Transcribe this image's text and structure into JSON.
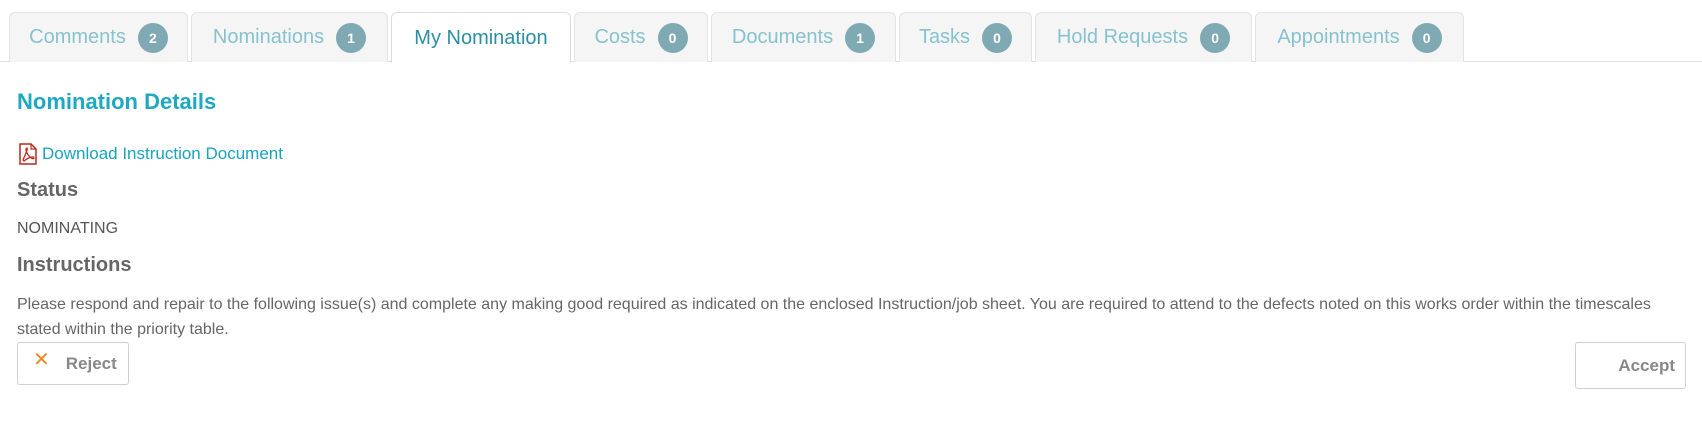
{
  "tabs": [
    {
      "label": "Comments",
      "count": "2",
      "active": false
    },
    {
      "label": "Nominations",
      "count": "1",
      "active": false
    },
    {
      "label": "My Nomination",
      "count": null,
      "active": true
    },
    {
      "label": "Costs",
      "count": "0",
      "active": false
    },
    {
      "label": "Documents",
      "count": "1",
      "active": false
    },
    {
      "label": "Tasks",
      "count": "0",
      "active": false
    },
    {
      "label": "Hold Requests",
      "count": "0",
      "active": false
    },
    {
      "label": "Appointments",
      "count": "0",
      "active": false
    }
  ],
  "section": {
    "title": "Nomination Details",
    "download_link": "Download Instruction Document",
    "download_icon": "pdf-icon",
    "status_label": "Status",
    "status_value": "NOMINATING",
    "instructions_label": "Instructions",
    "instructions_text": "Please respond and repair to the following issue(s) and complete any making good required as indicated on the enclosed Instruction/job sheet. You are required to attend to the defects noted on this works order within the timescales stated within the priority table."
  },
  "actions": {
    "reject_label": "Reject",
    "reject_icon": "close-icon",
    "accept_label": "Accept"
  },
  "colors": {
    "accent": "#1fa8c2",
    "badge": "#80aab3",
    "tab_text": "#86c2cf",
    "reject_icon": "#f08a24"
  }
}
